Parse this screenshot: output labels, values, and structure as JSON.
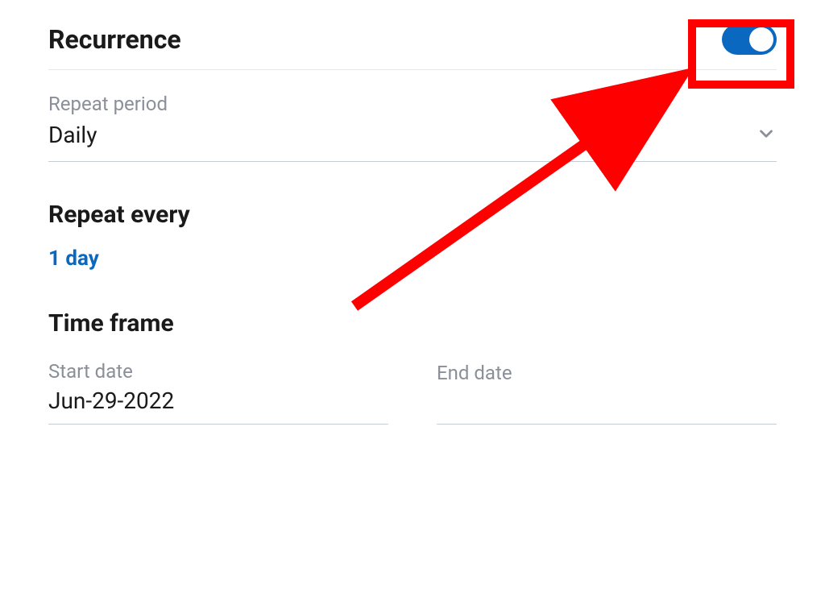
{
  "recurrence": {
    "title": "Recurrence",
    "toggle_on": true
  },
  "repeat_period": {
    "label": "Repeat period",
    "value": "Daily"
  },
  "repeat_every": {
    "title": "Repeat every",
    "value": "1 day"
  },
  "time_frame": {
    "title": "Time frame",
    "start_date": {
      "label": "Start date",
      "value": "Jun-29-2022"
    },
    "end_date": {
      "label": "End date",
      "value": ""
    }
  }
}
